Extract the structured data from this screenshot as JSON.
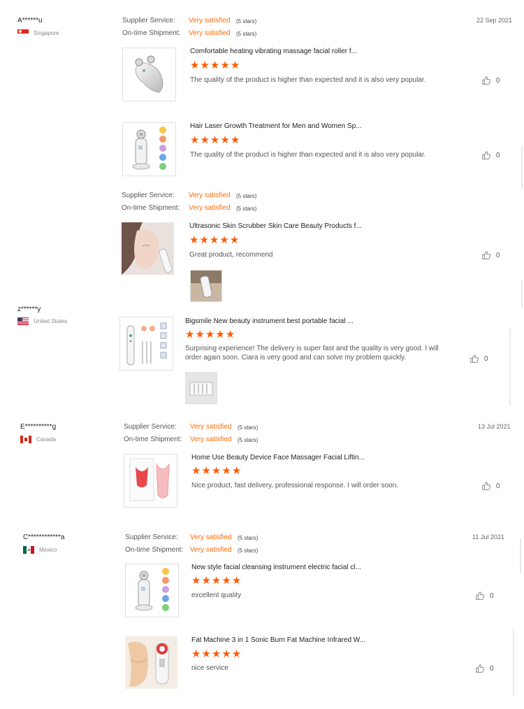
{
  "labels": {
    "supplier_service": "Supplier Service:",
    "ontime_shipment": "On-time Shipment:",
    "very_satisfied": "Very satisfied",
    "five_stars": "(5 stars)"
  },
  "colors": {
    "accent": "#ff6a00",
    "star": "#ff5a00"
  },
  "reviewers": [
    {
      "name": "A******u",
      "country": "Singapore",
      "date": "22 Sep 2021"
    },
    {
      "name": "z******y",
      "country": "United States",
      "date": ""
    },
    {
      "name": "E**********g",
      "country": "Canada",
      "date": "13 Jul 2021"
    },
    {
      "name": "C************a",
      "country": "Mexico",
      "date": "11 Jul 2021"
    }
  ],
  "reviews": [
    {
      "title": "Comfortable heating vibrating massage facial roller f...",
      "rating": 5,
      "text": "The quality of the product is higher than expected and it is also very popular.",
      "likes": "0",
      "thumb_icon": "facial-roller-icon"
    },
    {
      "title": "Hair Laser Growth Treatment for Men and Women Sp...",
      "rating": 5,
      "text": "The quality of the product is higher than expected and it is also very popular.",
      "likes": "0",
      "thumb_icon": "beauty-device-icon"
    },
    {
      "title": "Ultrasonic Skin Scrubber Skin Care Beauty Products f...",
      "rating": 5,
      "text": "Great product, recommend",
      "likes": "0",
      "thumb_icon": "woman-face-photo"
    },
    {
      "title": "Bigsmile New beauty instrument best portable facial ...",
      "rating": 5,
      "text": "Surprising experience! The delivery is super fast and the quality is very good. I will order again soon. Ciara is very good and can solve my problem quickly.",
      "likes": "0",
      "thumb_icon": "blackhead-remover-icon"
    },
    {
      "title": "Home Use Beauty Device Face Massager Facial Liftin...",
      "rating": 5,
      "text": "Nice product, fast delivery, professional response. I will order soon.",
      "likes": "0",
      "thumb_icon": "neck-massager-icon"
    },
    {
      "title": "New style facial cleansing instrument electric facial cl...",
      "rating": 5,
      "text": "excellent quality",
      "likes": "0",
      "thumb_icon": "beauty-device-icon"
    },
    {
      "title": "Fat Machine 3 in 1 Sonic Burn Fat Machine Infrared W...",
      "rating": 5,
      "text": "nice service",
      "likes": "0",
      "thumb_icon": "fat-machine-icon"
    }
  ]
}
